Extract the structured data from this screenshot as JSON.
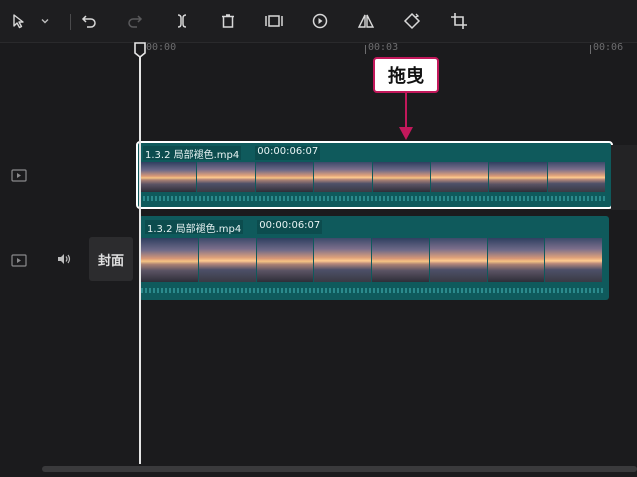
{
  "toolbar": {
    "items": [
      {
        "name": "select-tool-icon"
      },
      {
        "name": "chevron-down-icon"
      },
      {
        "name": "undo-icon"
      },
      {
        "name": "redo-icon"
      },
      {
        "name": "split-icon"
      },
      {
        "name": "delete-icon"
      },
      {
        "name": "freeze-frame-icon"
      },
      {
        "name": "reverse-icon"
      },
      {
        "name": "mirror-icon"
      },
      {
        "name": "rotate-icon"
      },
      {
        "name": "crop-icon"
      }
    ]
  },
  "ruler": {
    "labels": [
      "00:00",
      "00:03",
      "00:06"
    ]
  },
  "tracks": {
    "clip_top": {
      "name": "1.3.2  局部褪色.mp4",
      "duration": "00:00:06:07"
    },
    "clip_main": {
      "name": "1.3.2  局部褪色.mp4",
      "duration": "00:00:06:07"
    },
    "cover_label": "封面"
  },
  "callout": {
    "text": "拖曳"
  },
  "colors": {
    "accent": "#c2185b",
    "clip": "#0f5a5c",
    "background": "#1b1b1d"
  }
}
